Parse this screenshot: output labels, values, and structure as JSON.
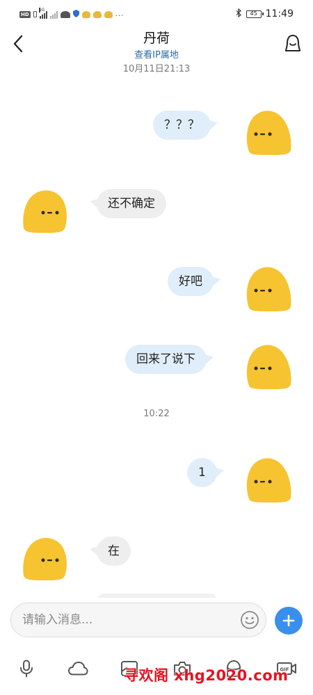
{
  "status_bar": {
    "left_indicators": [
      "HD",
      "5G"
    ],
    "overflow": "...",
    "battery": "45",
    "time": "11:49",
    "icons": [
      "hd-icon",
      "sim-icon",
      "signal-icon",
      "signal-off-icon",
      "android-icon",
      "shield-icon",
      "app-icon",
      "app-icon",
      "app-icon",
      "bluetooth-icon",
      "battery-icon"
    ]
  },
  "header": {
    "title": "丹荷",
    "subtitle": "查看IP属地",
    "back_icon": "chevron-left-icon",
    "profile_icon": "profile-icon"
  },
  "chat": {
    "timestamps": [
      "10月11日21:13",
      "10:22"
    ],
    "messages": [
      {
        "side": "out",
        "text": "？？？"
      },
      {
        "side": "in",
        "text": "还不确定"
      },
      {
        "side": "out",
        "text": "好吧"
      },
      {
        "side": "out",
        "text": "回来了说下"
      },
      {
        "side": "out",
        "text": "1"
      },
      {
        "side": "in",
        "text": "在"
      }
    ]
  },
  "input": {
    "placeholder": "请输入消息...",
    "emoji_icon": "emoji-icon",
    "add_icon": "plus-icon"
  },
  "toolbar": {
    "items": [
      "microphone-icon",
      "cloud-icon",
      "image-icon",
      "camera-icon",
      "red-packet-icon",
      "gif-icon"
    ],
    "gif_label": "GIF"
  },
  "watermark": "寻欢阁 xhg2020.com",
  "colors": {
    "bubble_out": "#e0eefb",
    "bubble_in": "#eeeeee",
    "accent": "#3b8fec",
    "link": "#2b6aa8",
    "avatar_yellow": "#f6c331"
  }
}
